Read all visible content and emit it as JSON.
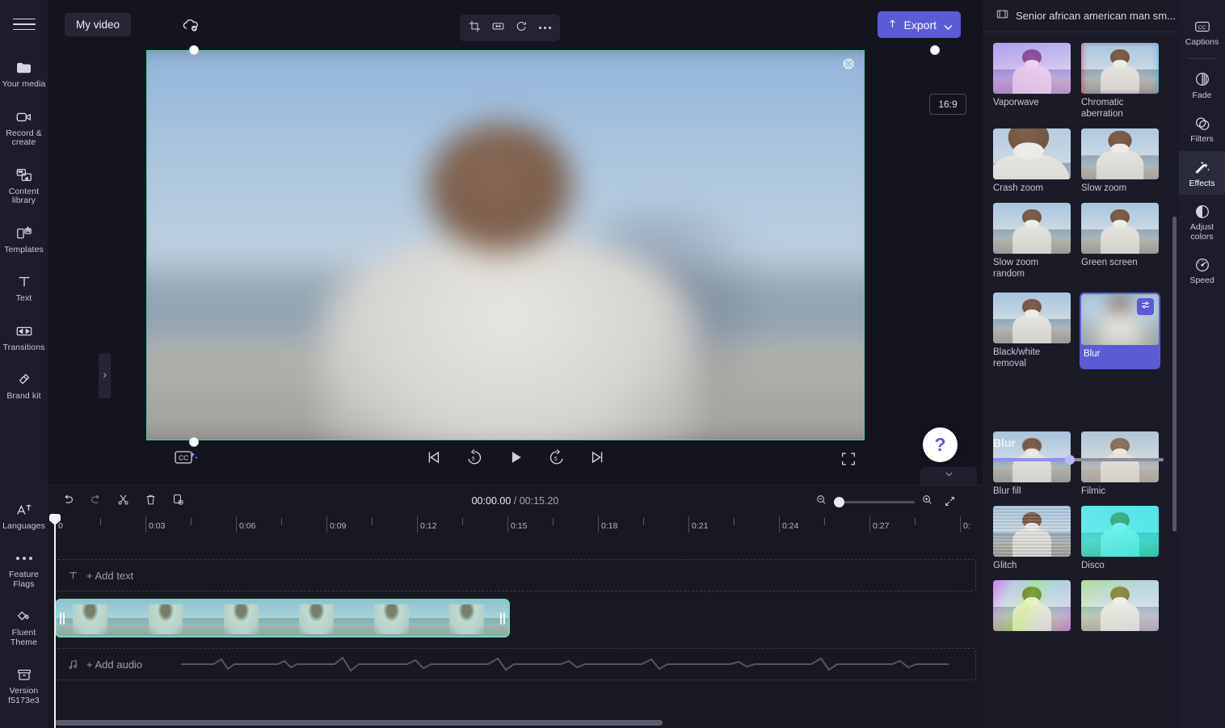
{
  "left_rail": {
    "menu_icon": "hamburger-icon",
    "items": [
      {
        "label": "Your media",
        "icon": "folder-icon"
      },
      {
        "label": "Record & create",
        "icon": "video-camera-icon"
      },
      {
        "label": "Content library",
        "icon": "content-library-icon"
      },
      {
        "label": "Templates",
        "icon": "templates-icon"
      },
      {
        "label": "Text",
        "icon": "text-icon"
      },
      {
        "label": "Transitions",
        "icon": "transitions-icon"
      },
      {
        "label": "Brand kit",
        "icon": "brand-kit-icon"
      }
    ],
    "bottom_items": [
      {
        "label": "Languages",
        "icon": "languages-icon"
      },
      {
        "label": "Feature Flags",
        "icon": "three-dots-icon"
      },
      {
        "label": "Fluent Theme",
        "icon": "paint-drop-icon"
      },
      {
        "label": "Version f5173e3",
        "icon": "archive-icon"
      }
    ]
  },
  "topbar": {
    "project_name": "My video",
    "cloud_status_icon": "cloud-saved-icon",
    "tools": [
      {
        "name": "crop-tool",
        "icon": "crop-icon"
      },
      {
        "name": "fit-tool",
        "icon": "fit-horizontal-icon"
      },
      {
        "name": "rotate-tool",
        "icon": "rotate-icon"
      },
      {
        "name": "more-tool",
        "icon": "more-horizontal-icon"
      }
    ],
    "export_label": "Export",
    "export_color": "#5b5bd6"
  },
  "preview": {
    "aspect_ratio": "16:9",
    "settings_icon": "gear-icon",
    "selection_color": "#5ac5b0",
    "captions_button": "cc-sparkle-icon",
    "transport": [
      {
        "name": "skip-to-start-button",
        "icon": "skip-previous-icon"
      },
      {
        "name": "rewind-5-button",
        "icon": "rewind-5-icon"
      },
      {
        "name": "play-button",
        "icon": "play-icon"
      },
      {
        "name": "forward-5-button",
        "icon": "forward-5-icon"
      },
      {
        "name": "skip-to-end-button",
        "icon": "skip-next-icon"
      }
    ],
    "fullscreen_icon": "fullscreen-icon",
    "help_label": "?"
  },
  "timeline": {
    "tools": [
      {
        "name": "undo-button",
        "icon": "undo-icon"
      },
      {
        "name": "redo-button",
        "icon": "redo-icon"
      },
      {
        "name": "split-button",
        "icon": "scissors-icon"
      },
      {
        "name": "delete-button",
        "icon": "trash-icon"
      },
      {
        "name": "duplicate-button",
        "icon": "duplicate-icon"
      }
    ],
    "current_time": "00:00.00",
    "total_time": "/ 00:15.20",
    "zoom_out_icon": "zoom-out-icon",
    "zoom_in_icon": "zoom-in-icon",
    "fit_icon": "fit-to-screen-icon",
    "zoom_value": 0,
    "ruler_labels": [
      "0",
      "0:03",
      "0:06",
      "0:09",
      "0:12",
      "0:15",
      "0:18",
      "0:21",
      "0:24",
      "0:27",
      "0:"
    ],
    "tracks": [
      {
        "name": "text-track",
        "label": "+ Add text",
        "icon": "text-t-icon"
      },
      {
        "name": "video-track",
        "label": "",
        "icon": ""
      },
      {
        "name": "audio-track",
        "label": "+ Add audio",
        "icon": "music-note-icon"
      }
    ]
  },
  "effects_panel": {
    "clip_title": "Senior african american man sm...",
    "clip_icon": "film-strip-icon",
    "effects": [
      {
        "label": "Vaporwave",
        "style": "vapor"
      },
      {
        "label": "Chromatic aberration",
        "style": "chroma"
      },
      {
        "label": "Crash zoom",
        "style": "crash"
      },
      {
        "label": "Slow zoom",
        "style": "slow"
      },
      {
        "label": "Slow zoom random",
        "style": "slowrand"
      },
      {
        "label": "Green screen",
        "style": "green"
      },
      {
        "label": "Black/white removal",
        "style": "bwremoval"
      },
      {
        "label": "Blur",
        "style": "blur",
        "selected": true,
        "settings_icon": "sliders-icon"
      },
      {
        "label": "Blur fill",
        "style": "blurfill"
      },
      {
        "label": "Filmic",
        "style": "filmic"
      },
      {
        "label": "Glitch",
        "style": "glitch"
      },
      {
        "label": "Disco",
        "style": "disco"
      },
      {
        "label": "",
        "style": "psych"
      },
      {
        "label": "",
        "style": "green2"
      }
    ],
    "slider": {
      "label": "Blur",
      "value": 45,
      "fill_color": "#8f8ff0"
    }
  },
  "right_rail": {
    "items": [
      {
        "label": "Captions",
        "icon": "cc-icon",
        "active": false
      },
      {
        "label": "Fade",
        "icon": "fade-icon",
        "active": false
      },
      {
        "label": "Filters",
        "icon": "filters-icon",
        "active": false
      },
      {
        "label": "Effects",
        "icon": "magic-wand-icon",
        "active": true
      },
      {
        "label": "Adjust colors",
        "icon": "contrast-icon",
        "active": false
      },
      {
        "label": "Speed",
        "icon": "speedometer-icon",
        "active": false
      }
    ]
  }
}
